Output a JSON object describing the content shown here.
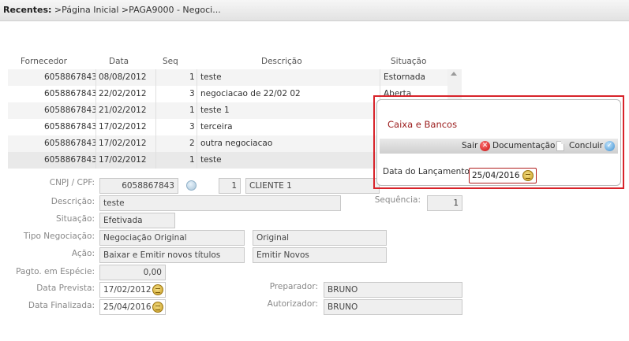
{
  "breadcrumb": {
    "label": "Recentes:",
    "path": " >Página Inicial  >PAGA9000 - Negoci..."
  },
  "grid": {
    "headers": {
      "fornecedor": "Fornecedor",
      "data": "Data",
      "seq": "Seq",
      "descricao": "Descrição",
      "situacao": "Situação"
    },
    "rows": [
      {
        "fornecedor": "6058867843",
        "data": "08/08/2012",
        "seq": "1",
        "descricao": "teste",
        "situacao": "Estornada"
      },
      {
        "fornecedor": "6058867843",
        "data": "22/02/2012",
        "seq": "3",
        "descricao": "negociacao de 22/02 02",
        "situacao": "Aberta"
      },
      {
        "fornecedor": "6058867843",
        "data": "21/02/2012",
        "seq": "1",
        "descricao": "teste 1",
        "situacao": ""
      },
      {
        "fornecedor": "6058867843",
        "data": "17/02/2012",
        "seq": "3",
        "descricao": "terceira",
        "situacao": ""
      },
      {
        "fornecedor": "6058867843",
        "data": "17/02/2012",
        "seq": "2",
        "descricao": "outra negociacao",
        "situacao": ""
      },
      {
        "fornecedor": "6058867843",
        "data": "17/02/2012",
        "seq": "1",
        "descricao": "teste",
        "situacao": ""
      }
    ]
  },
  "form": {
    "cnpj_label": "CNPJ / CPF:",
    "cnpj_value": "6058867843",
    "cliente_seq": "1",
    "cliente_nome": "CLIENTE 1",
    "descricao_label": "Descrição:",
    "descricao_value": "teste",
    "sequencia_label": "Sequência:",
    "sequencia_value": "1",
    "situacao_label": "Situação:",
    "situacao_value": "Efetivada",
    "tipo_label": "Tipo Negociação:",
    "tipo_value": "Negociação Original",
    "tipo_value2": "Original",
    "acao_label": "Ação:",
    "acao_value": "Baixar e Emitir novos títulos",
    "acao_value2": "Emitir Novos",
    "pagto_label": "Pagto. em Espécie:",
    "pagto_value": "0,00",
    "prevista_label": "Data Prevista:",
    "prevista_value": "17/02/2012",
    "finalizada_label": "Data Finalizada:",
    "finalizada_value": "25/04/2016",
    "preparador_label": "Preparador:",
    "preparador_value": "BRUNO",
    "autorizador_label": "Autorizador:",
    "autorizador_value": "BRUNO"
  },
  "popup": {
    "title": "Caixa e Bancos",
    "sair": "Sair",
    "documentacao": "Documentação",
    "concluir": "Concluir",
    "date_label": "Data do Lançamento:",
    "date_value": "25/04/2016",
    "accent": "#d8232a"
  }
}
